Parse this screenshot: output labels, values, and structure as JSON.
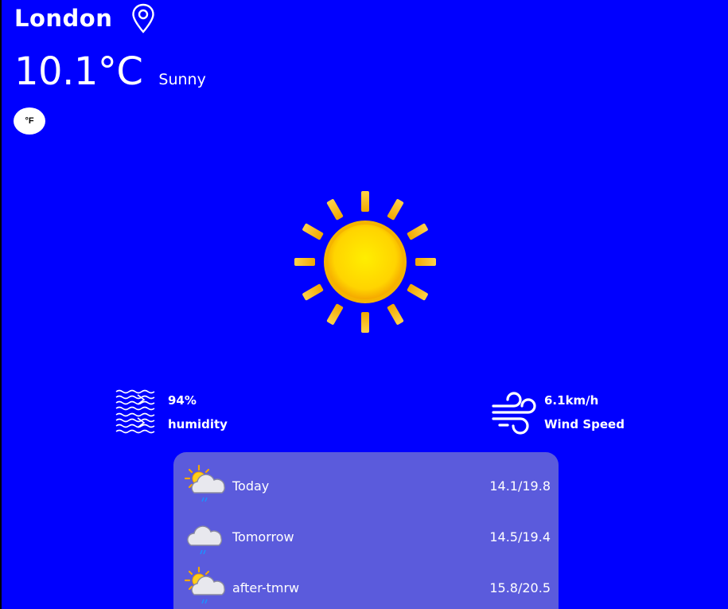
{
  "location": {
    "city": "London",
    "icon": "location-pin-icon"
  },
  "current": {
    "temperature": "10.1°C",
    "condition": "Sunny",
    "icon": "sun-icon"
  },
  "unit_toggle": {
    "label": "°F"
  },
  "stats": {
    "humidity": {
      "value": "94%",
      "label": "humidity",
      "icon": "humidity-waves-icon"
    },
    "wind": {
      "value": "6.1km/h",
      "label": "Wind Speed",
      "icon": "wind-icon"
    }
  },
  "forecast": [
    {
      "day": "Today",
      "range": "14.1/19.8",
      "icon": "sun-cloud-rain-icon"
    },
    {
      "day": "Tomorrow",
      "range": "14.5/19.4",
      "icon": "cloud-rain-icon"
    },
    {
      "day": "after-tmrw",
      "range": "15.8/20.5",
      "icon": "sun-cloud-rain-icon"
    }
  ],
  "colors": {
    "background": "#0000ff",
    "forecast_panel": "#5b5bdc",
    "text": "#ffffff",
    "sun": "#ffcc00"
  }
}
